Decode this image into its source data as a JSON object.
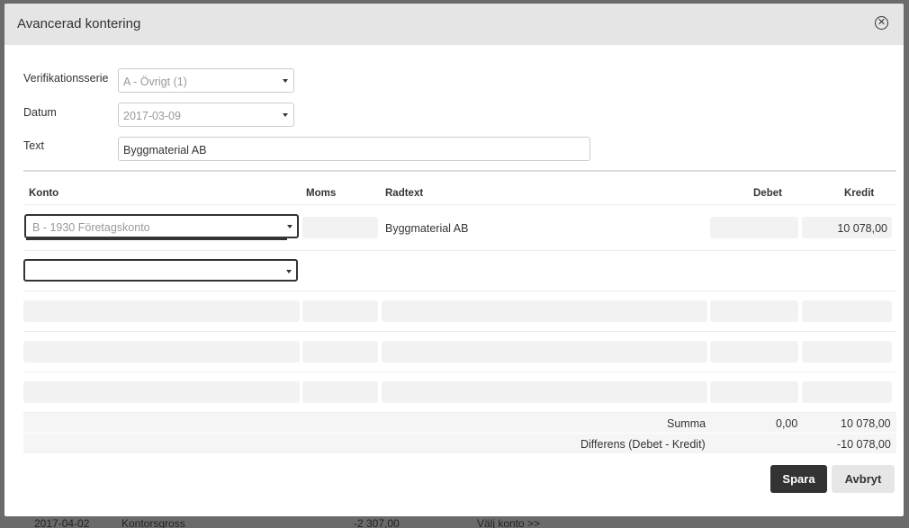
{
  "dialog": {
    "title": "Avancerad kontering"
  },
  "form": {
    "series_label": "Verifikationsserie",
    "series_value": "A - Övrigt (1)",
    "date_label": "Datum",
    "date_value": "2017-03-09",
    "text_label": "Text",
    "text_value": "Byggmaterial AB"
  },
  "table": {
    "headers": {
      "konto": "Konto",
      "moms": "Moms",
      "radtext": "Radtext",
      "debet": "Debet",
      "kredit": "Kredit"
    },
    "rows": [
      {
        "konto": "B - 1930 Företagskonto",
        "moms": "",
        "radtext": "Byggmaterial AB",
        "debet": "",
        "kredit": "10 078,00"
      },
      {
        "konto": "",
        "moms": "",
        "radtext": "",
        "debet": "",
        "kredit": ""
      }
    ]
  },
  "summary": {
    "summa_label": "Summa",
    "summa_debet": "0,00",
    "summa_kredit": "10 078,00",
    "diff_label": "Differens (Debet - Kredit)",
    "diff_value": "-10 078,00"
  },
  "buttons": {
    "save": "Spara",
    "cancel": "Avbryt"
  },
  "background_row": {
    "date": "2017-04-02",
    "name": "Kontorsgross",
    "amount": "-2 307,00",
    "link": "Välj konto >>"
  },
  "icons": {
    "close": "close-circle-icon",
    "caret": "caret-down-icon"
  }
}
